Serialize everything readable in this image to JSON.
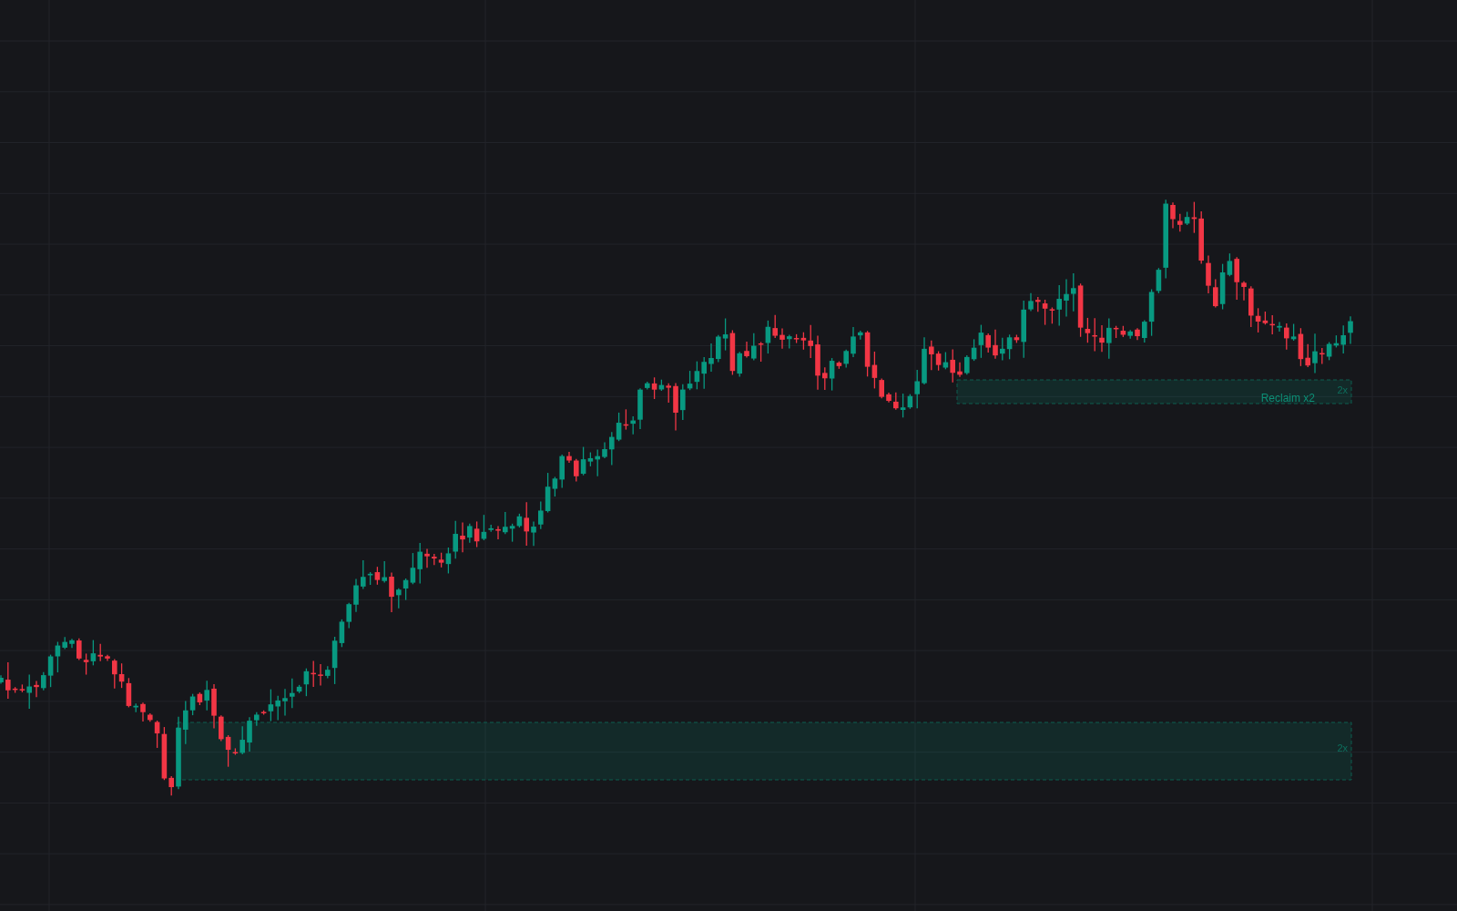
{
  "chart": {
    "zones": [
      {
        "label": "2x",
        "note": "Reclaim x2"
      },
      {
        "label": "2x"
      }
    ]
  }
}
